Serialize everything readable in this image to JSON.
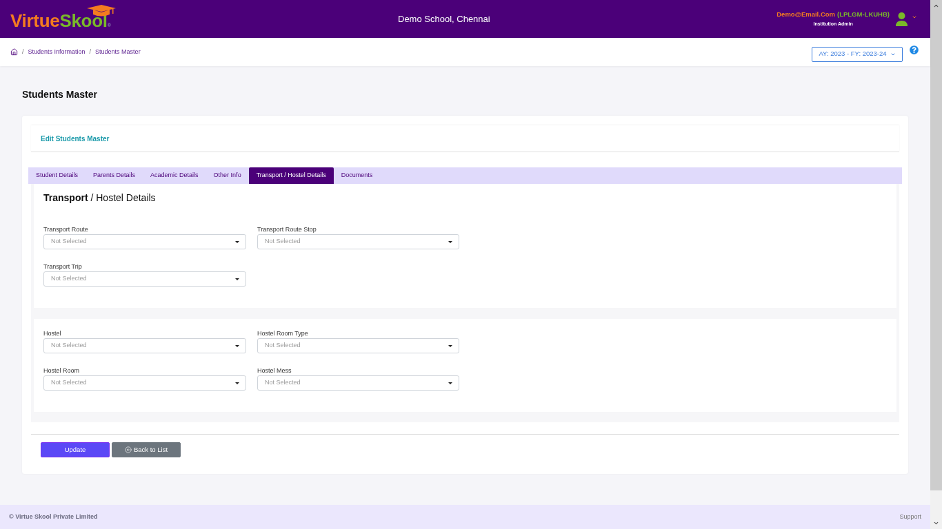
{
  "header": {
    "logo": {
      "first": "Virtue",
      "second": "Skool",
      "mark": "®"
    },
    "school": "Demo School, Chennai",
    "user": {
      "email": "Demo@Email.Com",
      "code": "(LPLGM-LKUHB)",
      "role": "Institution Admin"
    }
  },
  "breadcrumb": {
    "items": [
      {
        "separator": "/",
        "label": "Students Information"
      },
      {
        "separator": "/",
        "label": "Students Master"
      }
    ]
  },
  "year_select": {
    "value": "AY: 2023 - FY: 2023-24"
  },
  "page_title": "Students Master",
  "card": {
    "title": "Edit Students Master",
    "tabs": [
      {
        "label": "Student Details",
        "selected": false
      },
      {
        "label": "Parents Details",
        "selected": false
      },
      {
        "label": "Academic Details",
        "selected": false
      },
      {
        "label": "Other Info",
        "selected": false
      },
      {
        "label": "Transport / Hostel Details",
        "selected": true
      },
      {
        "label": "Documents",
        "selected": false
      }
    ],
    "sections": [
      {
        "heading": "**Transport** / Hostel Details",
        "fields": [
          {
            "label": "Transport Route",
            "placeholder": "Not Selected"
          },
          {
            "label": "Transport Route Stop",
            "placeholder": "Not Selected"
          },
          {
            "label": "Transport Trip",
            "placeholder": "Not Selected"
          }
        ]
      },
      {
        "fields": [
          {
            "label": "Hostel",
            "placeholder": "Not Selected"
          },
          {
            "label": "Hostel Room Type",
            "placeholder": "Not Selected"
          },
          {
            "label": "Hostel Room",
            "placeholder": "Not Selected"
          },
          {
            "label": "Hostel Mess",
            "placeholder": "Not Selected"
          }
        ]
      }
    ],
    "buttons": [
      {
        "kind": "primary",
        "label": "Update"
      },
      {
        "kind": "back",
        "label": "Back to List"
      }
    ]
  },
  "footer": {
    "copyright": "© Virtue Skool Private Limited",
    "support": "Support"
  }
}
